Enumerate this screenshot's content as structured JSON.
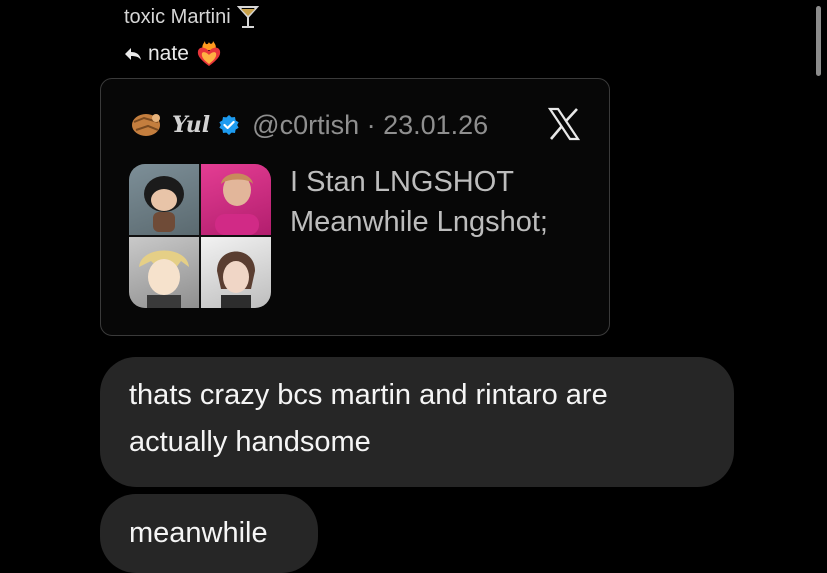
{
  "header": {
    "sender_name": "toxic Martini",
    "reply_to": "nate"
  },
  "quoted_tweet": {
    "display_name": "Yul",
    "handle_date": "@c0rtish · 23.01.26",
    "text_lines": [
      "I Stan LNGSHOT",
      "Meanwhile Lngshot;"
    ]
  },
  "messages": [
    {
      "text_lines": [
        "thats crazy bcs martin and rintaro are",
        "actually handsome"
      ]
    },
    {
      "text": "meanwhile"
    }
  ],
  "colors": {
    "background": "#000000",
    "bubble": "#262626",
    "verified": "#1d9bf0"
  }
}
